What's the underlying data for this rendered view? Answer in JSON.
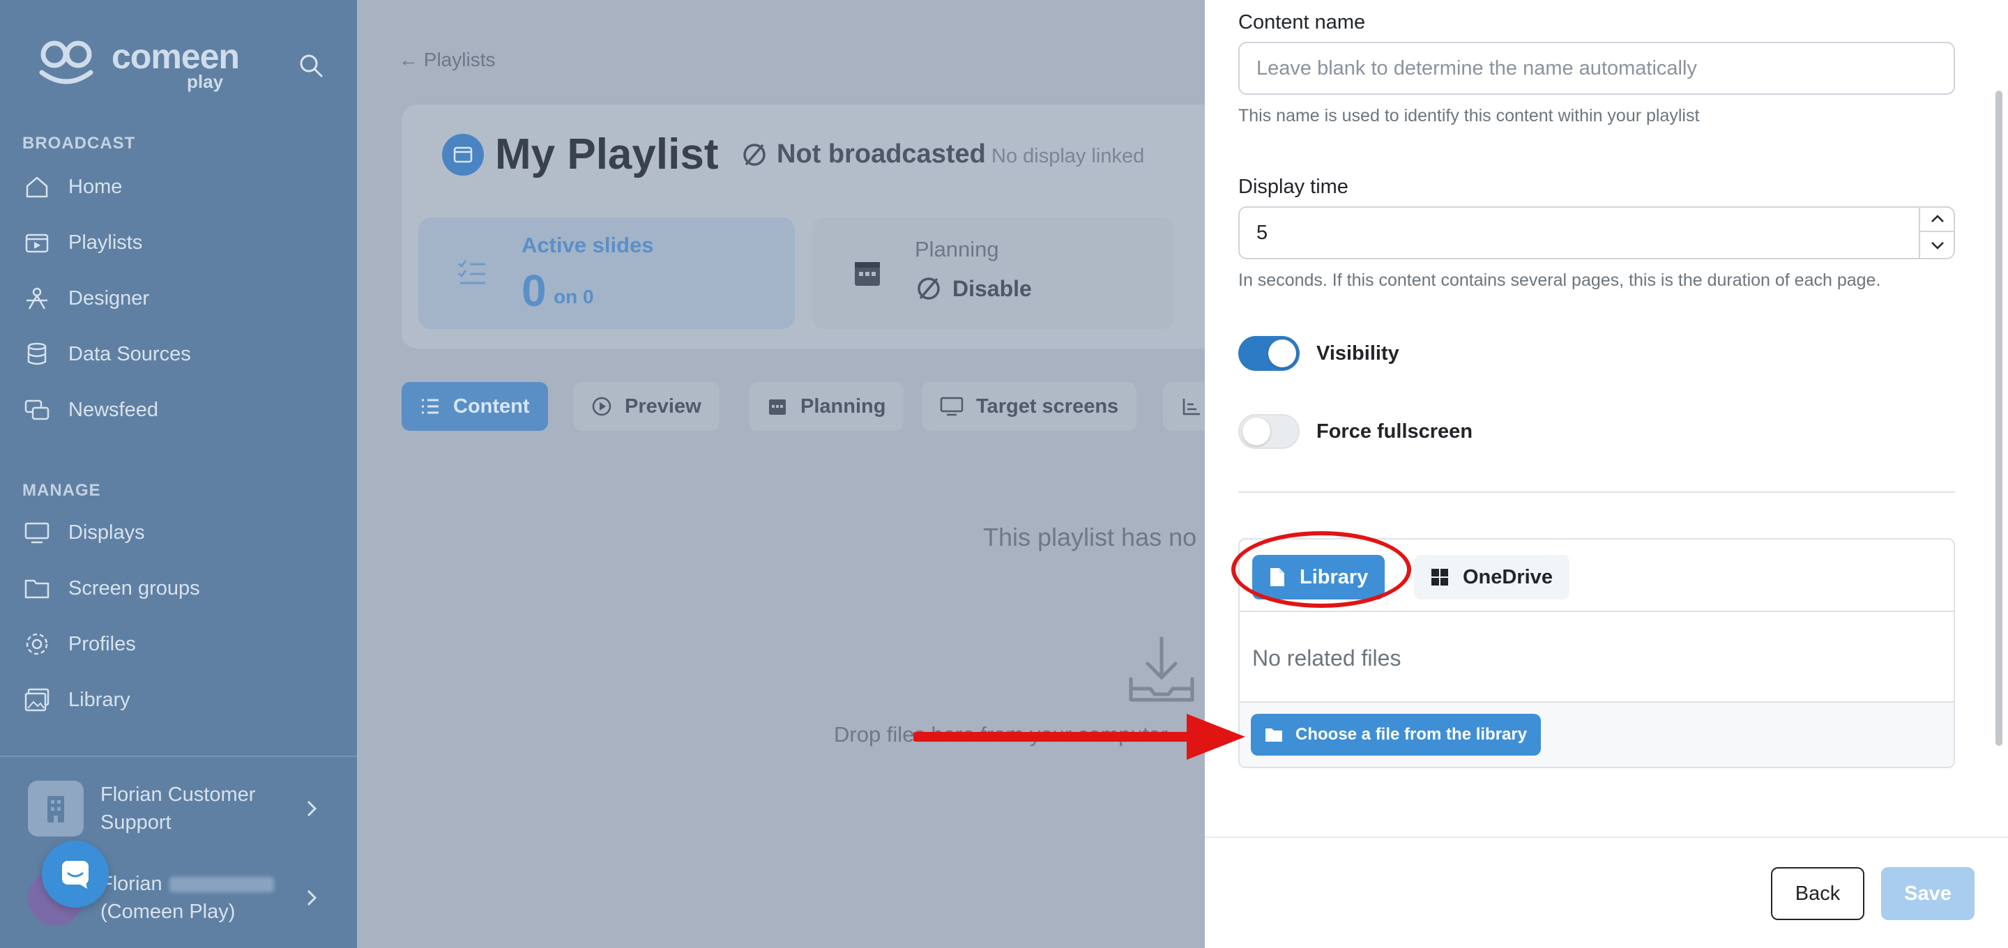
{
  "sidebar": {
    "logo_text": "comeen",
    "logo_sub": "play",
    "sections": {
      "broadcast": "BROADCAST",
      "manage": "MANAGE"
    },
    "items": [
      {
        "label": "Home"
      },
      {
        "label": "Playlists"
      },
      {
        "label": "Designer"
      },
      {
        "label": "Data Sources"
      },
      {
        "label": "Newsfeed"
      },
      {
        "label": "Displays"
      },
      {
        "label": "Screen groups"
      },
      {
        "label": "Profiles"
      },
      {
        "label": "Library"
      }
    ],
    "accounts": [
      {
        "line1": "Florian Customer",
        "line2": "Support"
      },
      {
        "line1": "Florian",
        "line2": "(Comeen Play)"
      }
    ]
  },
  "main": {
    "breadcrumb": "Playlists",
    "title": "My Playlist",
    "status": "Not broadcasted",
    "no_display": "No display linked",
    "stats": {
      "active_slides_label": "Active slides",
      "active_slides_value": "0",
      "active_slides_total": "on 0",
      "planning_label": "Planning",
      "planning_value": "Disable"
    },
    "tabs": [
      "Content",
      "Preview",
      "Planning",
      "Target screens"
    ],
    "empty_text": "This playlist has no",
    "drop_text": "Drop files here from your computer"
  },
  "panel": {
    "content_name": {
      "label": "Content name",
      "placeholder": "Leave blank to determine the name automatically",
      "help": "This name is used to identify this content within your playlist"
    },
    "display_time": {
      "label": "Display time",
      "value": "5",
      "help": "In seconds. If this content contains several pages, this is the duration of each page."
    },
    "visibility": {
      "label": "Visibility",
      "on": true
    },
    "force_fullscreen": {
      "label": "Force fullscreen",
      "on": false
    },
    "file_tabs": {
      "library": "Library",
      "onedrive": "OneDrive"
    },
    "no_files": "No related files",
    "choose_button": "Choose a file from the library",
    "back": "Back",
    "save": "Save"
  },
  "colors": {
    "accent": "#3f8fd6",
    "toggle_on": "#2d7bc4",
    "annotation": "#e11414",
    "sidebar_bg": "#5f80a3"
  }
}
